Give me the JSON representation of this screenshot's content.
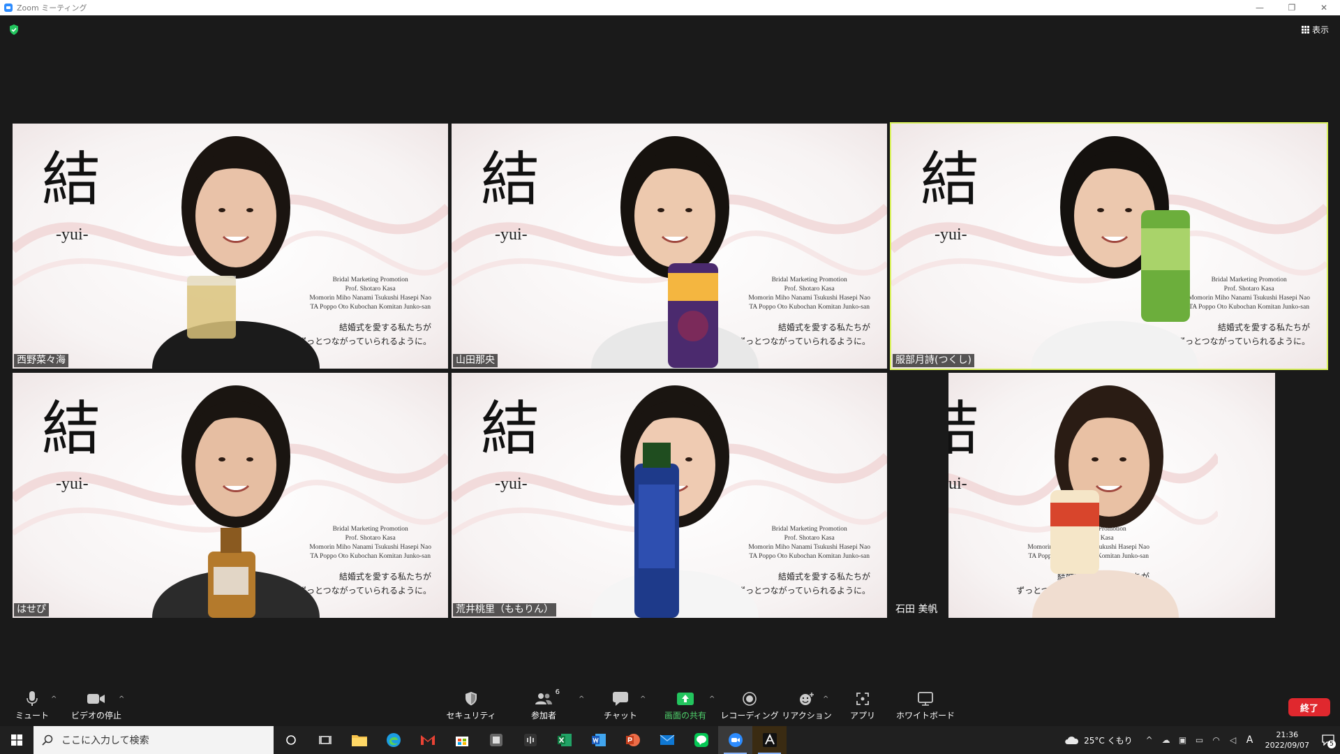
{
  "window": {
    "title": "Zoom ミーティング",
    "controls": [
      "—",
      "❐",
      "✕"
    ]
  },
  "meeting": {
    "view_label": "表示",
    "background": {
      "kanji": "結",
      "romaji": "-yui-",
      "credits": [
        "Bridal Marketing Promotion",
        "Prof. Shotaro Kasa",
        "Momorin Miho Nanami Tsukushi Hasepi Nao",
        "TA Poppo Oto Kubochan Komitan Junko-san"
      ],
      "tagline": [
        "結婚式を愛する私たちが",
        "ずっとつながっていられるように。"
      ]
    },
    "participants": [
      {
        "name": "西野菜々海",
        "active": false
      },
      {
        "name": "山田那央",
        "active": false
      },
      {
        "name": "服部月詩(つくし)",
        "active": true
      },
      {
        "name": "はせぴ",
        "active": false
      },
      {
        "name": "荒井桃里（ももりん）",
        "active": false
      },
      {
        "name": "石田 美帆",
        "active": false
      }
    ]
  },
  "toolbar": {
    "mute": "ミュート",
    "video": "ビデオの停止",
    "security": "セキュリティ",
    "participants": "参加者",
    "participants_count": "6",
    "chat": "チャット",
    "share": "画面の共有",
    "record": "レコーディング",
    "reactions": "リアクション",
    "apps": "アプリ",
    "whiteboard": "ホワイトボード",
    "end": "終了"
  },
  "taskbar": {
    "search_placeholder": "ここに入力して検索",
    "weather": "25°C くもり",
    "time": "21:36",
    "date": "2022/09/07",
    "ime": "A",
    "notification_count": "5"
  },
  "colors": {
    "active_speaker": "#d8f05a",
    "end_button": "#e0282e",
    "share_green": "#4ed06b",
    "zoom_blue": "#2d8cff"
  }
}
